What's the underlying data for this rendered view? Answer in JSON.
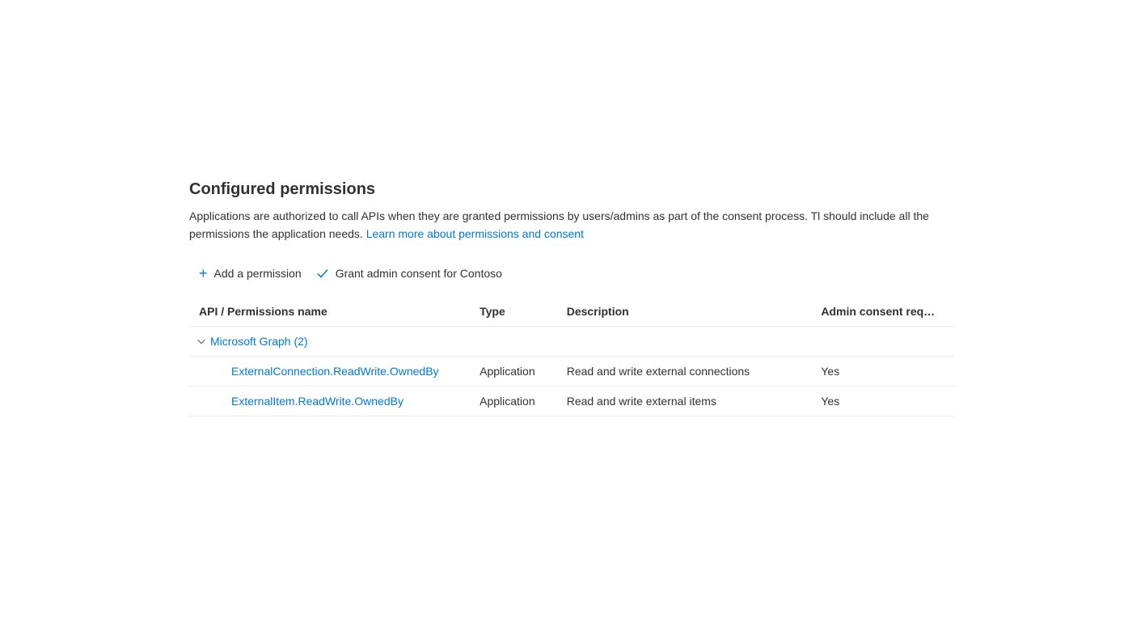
{
  "heading": "Configured permissions",
  "description_prefix": "Applications are authorized to call APIs when they are granted permissions by users/admins as part of the consent process. Tl should include all the permissions the application needs. ",
  "learn_more_label": "Learn more about permissions and consent",
  "toolbar": {
    "add_permission_label": "Add a permission",
    "grant_consent_label": "Grant admin consent for Contoso"
  },
  "columns": {
    "name": "API / Permissions name",
    "type": "Type",
    "description": "Description",
    "admin_consent": "Admin consent req…"
  },
  "group": {
    "label": "Microsoft Graph (2)"
  },
  "permissions": [
    {
      "name": "ExternalConnection.ReadWrite.OwnedBy",
      "type": "Application",
      "description": "Read and write external connections",
      "admin_consent": "Yes"
    },
    {
      "name": "ExternalItem.ReadWrite.OwnedBy",
      "type": "Application",
      "description": "Read and write external items",
      "admin_consent": "Yes"
    }
  ]
}
